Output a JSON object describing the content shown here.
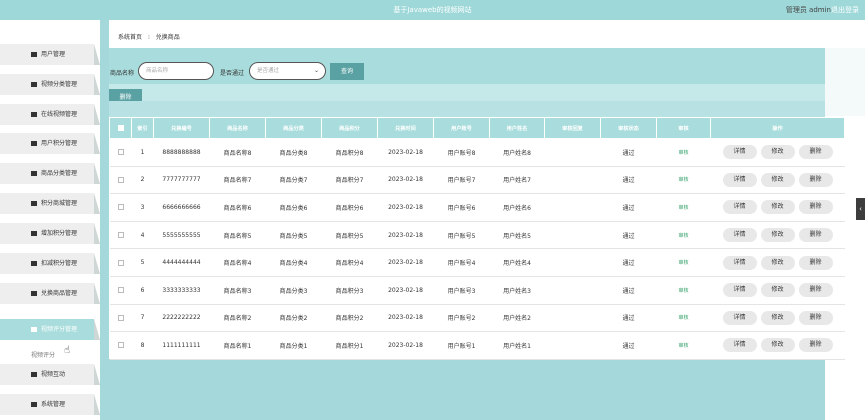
{
  "header": {
    "site_title": "基于Javaweb的视频网站",
    "user_label": "管理员 admin",
    "logout_label": "退出登录"
  },
  "sidebar": {
    "items": [
      {
        "label": "用户管理",
        "icon": "grid-icon"
      },
      {
        "label": "视频分类管理",
        "icon": "clipboard-icon"
      },
      {
        "label": "在线视频管理",
        "icon": "grid-icon"
      },
      {
        "label": "用户积分管理",
        "icon": "grid-icon"
      },
      {
        "label": "商品分类管理",
        "icon": "grid-icon"
      },
      {
        "label": "积分商城管理",
        "icon": "shop-icon"
      },
      {
        "label": "增加积分管理",
        "icon": "grid-icon"
      },
      {
        "label": "扣减积分管理",
        "icon": "user-icon"
      },
      {
        "label": "兑换商品管理",
        "icon": "grid-icon"
      },
      {
        "label": "视频评分管理",
        "icon": "monitor-icon"
      },
      {
        "label": "视频互动",
        "icon": "flag-icon"
      },
      {
        "label": "系统管理",
        "icon": "flag-icon"
      }
    ],
    "sub_item": "视频评分"
  },
  "breadcrumb": {
    "home": "系统首页",
    "separator": "⁝",
    "current": "兑换商品"
  },
  "search": {
    "name_label": "商品名称",
    "name_placeholder": "商品名称",
    "approved_label": "是否通过",
    "approved_placeholder": "是否通过",
    "query_button": "查询"
  },
  "actions": {
    "delete_button": "删除"
  },
  "table": {
    "headers": [
      "",
      "索引",
      "兑换编号",
      "商品名称",
      "商品分类",
      "商品积分",
      "兑换时间",
      "用户账号",
      "用户姓名",
      "审核回复",
      "审核状态",
      "审核",
      "操作"
    ],
    "rows": [
      {
        "index": "1",
        "code": "8888888888",
        "name": "商品名称8",
        "category": "商品分类8",
        "points": "商品积分8",
        "time": "2023-02-18",
        "account": "用户账号8",
        "username": "用户姓名8",
        "reply": "",
        "status": "通过",
        "review": "审核"
      },
      {
        "index": "2",
        "code": "7777777777",
        "name": "商品名称7",
        "category": "商品分类7",
        "points": "商品积分7",
        "time": "2023-02-18",
        "account": "用户账号7",
        "username": "用户姓名7",
        "reply": "",
        "status": "通过",
        "review": "审核"
      },
      {
        "index": "3",
        "code": "6666666666",
        "name": "商品名称6",
        "category": "商品分类6",
        "points": "商品积分6",
        "time": "2023-02-18",
        "account": "用户账号6",
        "username": "用户姓名6",
        "reply": "",
        "status": "通过",
        "review": "审核"
      },
      {
        "index": "4",
        "code": "5555555555",
        "name": "商品名称5",
        "category": "商品分类5",
        "points": "商品积分5",
        "time": "2023-02-18",
        "account": "用户账号5",
        "username": "用户姓名5",
        "reply": "",
        "status": "通过",
        "review": "审核"
      },
      {
        "index": "5",
        "code": "4444444444",
        "name": "商品名称4",
        "category": "商品分类4",
        "points": "商品积分4",
        "time": "2023-02-18",
        "account": "用户账号4",
        "username": "用户姓名4",
        "reply": "",
        "status": "通过",
        "review": "审核"
      },
      {
        "index": "6",
        "code": "3333333333",
        "name": "商品名称3",
        "category": "商品分类3",
        "points": "商品积分3",
        "time": "2023-02-18",
        "account": "用户账号3",
        "username": "用户姓名3",
        "reply": "",
        "status": "通过",
        "review": "审核"
      },
      {
        "index": "7",
        "code": "2222222222",
        "name": "商品名称2",
        "category": "商品分类2",
        "points": "商品积分2",
        "time": "2023-02-18",
        "account": "用户账号2",
        "username": "用户姓名2",
        "reply": "",
        "status": "通过",
        "review": "审核"
      },
      {
        "index": "8",
        "code": "1111111111",
        "name": "商品名称1",
        "category": "商品分类1",
        "points": "商品积分1",
        "time": "2023-02-18",
        "account": "用户账号1",
        "username": "用户姓名1",
        "reply": "",
        "status": "通过",
        "review": "审核"
      }
    ],
    "row_buttons": {
      "detail": "详情",
      "edit": "修改",
      "delete": "删除"
    }
  },
  "colors": {
    "accent": "#a9dcdc",
    "button": "#5aa1a3",
    "review_text": "#3aa36e"
  }
}
